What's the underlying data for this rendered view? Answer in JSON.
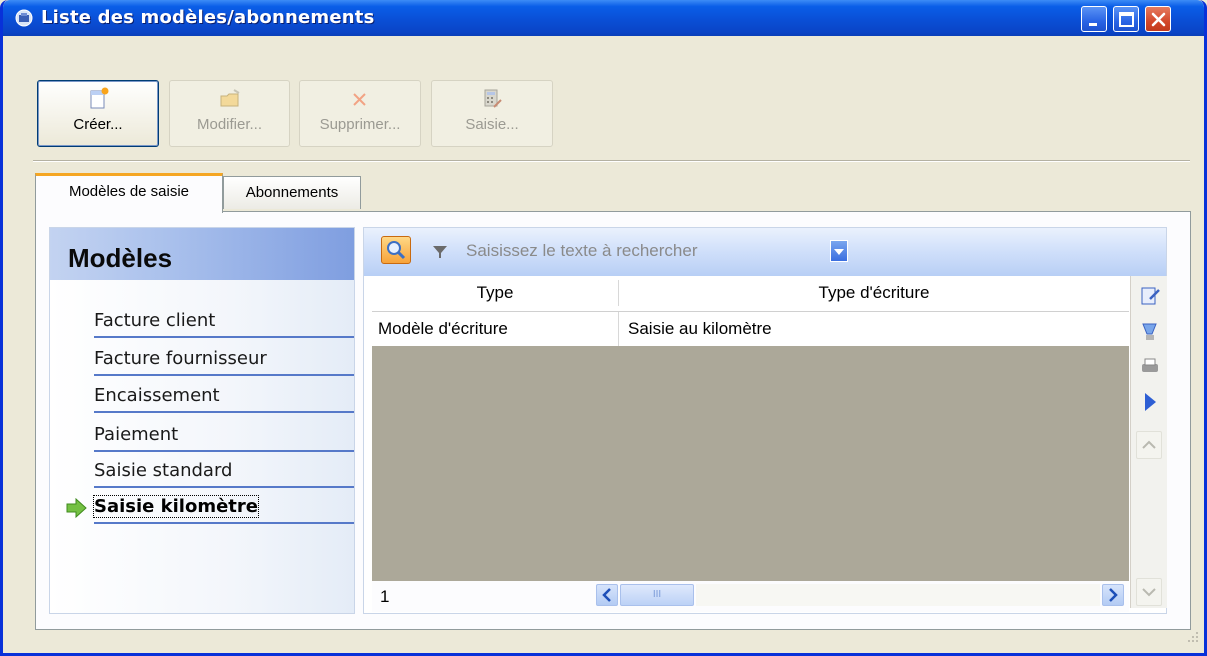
{
  "window": {
    "title": "Liste des modèles/abonnements"
  },
  "toolbar": {
    "create_label": "Créer...",
    "modify_label": "Modifier...",
    "delete_label": "Supprimer...",
    "entry_label": "Saisie..."
  },
  "tabs": [
    {
      "label": "Modèles de saisie",
      "selected": true
    },
    {
      "label": "Abonnements",
      "selected": false
    }
  ],
  "sidebar": {
    "title": "Modèles",
    "items": [
      {
        "label": "Facture client"
      },
      {
        "label": "Facture fournisseur"
      },
      {
        "label": "Encaissement"
      },
      {
        "label": "Paiement"
      },
      {
        "label": "Saisie standard"
      },
      {
        "label": "Saisie kilomètre",
        "current": true
      }
    ]
  },
  "search": {
    "placeholder": "Saisissez le texte à rechercher"
  },
  "grid": {
    "columns": [
      "Type",
      "Type d'écriture"
    ],
    "rows": [
      [
        "Modèle d'écriture",
        "Saisie au kilomètre"
      ]
    ],
    "record_count": "1",
    "scroll_thumb_label": "III"
  },
  "colors": {
    "titlebar": "#0a4fd6",
    "tab_highlight": "#f5a623",
    "sidebar_header": "#a9c0ec",
    "grid_empty": "#aca899",
    "nav_underline": "#5679c9"
  }
}
